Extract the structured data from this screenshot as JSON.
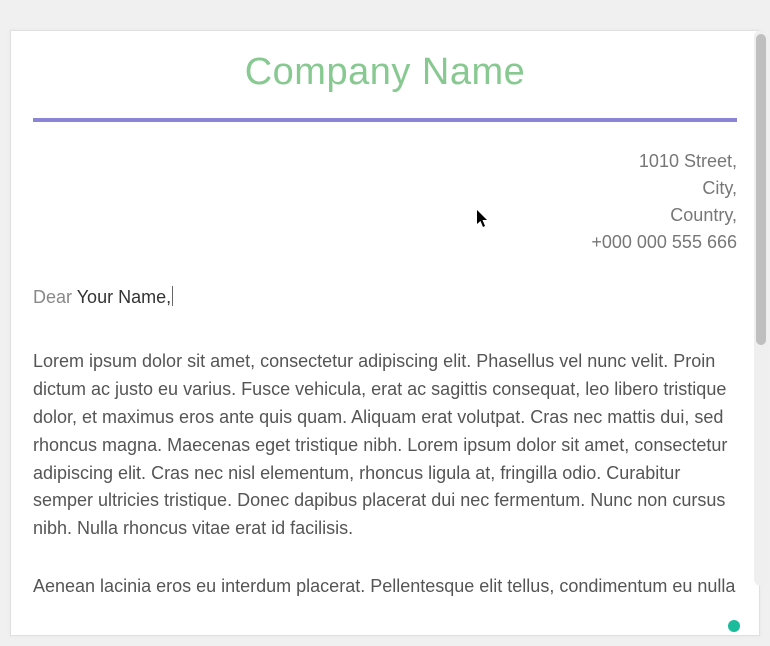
{
  "header": {
    "company_name": "Company Name"
  },
  "address": {
    "line1": "1010 Street,",
    "line2": "City,",
    "line3": "Country,",
    "phone": "+000 000 555 666"
  },
  "salutation": {
    "dear": "Dear",
    "name": "Your Name,"
  },
  "body": {
    "p1": "Lorem ipsum dolor sit amet, consectetur adipiscing elit. Phasellus vel nunc velit. Proin dictum ac justo eu varius. Fusce vehicula, erat ac sagittis consequat, leo libero tristique dolor, et maximus eros ante quis quam. Aliquam erat volutpat. Cras nec mattis dui, sed rhoncus magna. Maecenas eget tristique nibh. Lorem ipsum dolor sit amet, consectetur adipiscing elit. Cras nec nisl elementum, rhoncus ligula at, fringilla odio. Curabitur semper ultricies tristique. Donec dapibus placerat dui nec fermentum. Nunc non cursus nibh. Nulla rhoncus vitae erat id facilisis.",
    "p2": "Aenean lacinia eros eu interdum placerat. Pellentesque elit tellus, condimentum eu nulla"
  }
}
